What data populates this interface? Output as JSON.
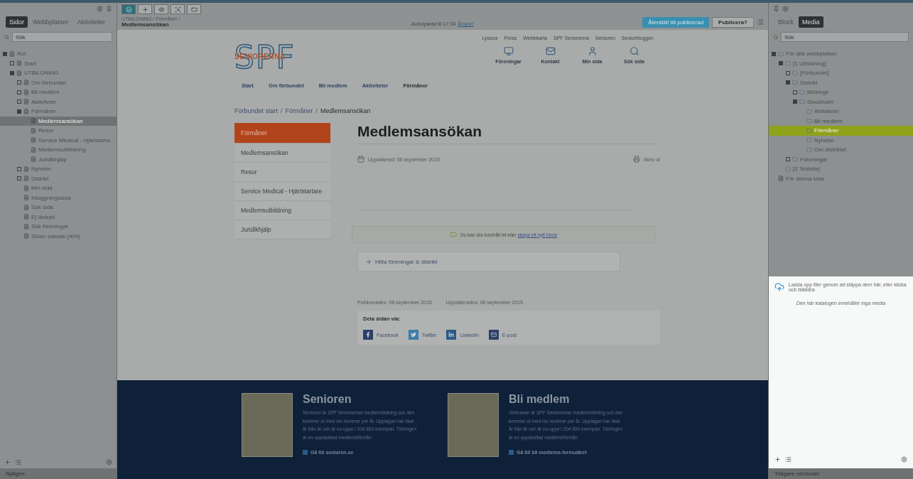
{
  "left_panel": {
    "tabs": [
      {
        "label": "Sidor",
        "selected": true
      },
      {
        "label": "Webbplatser",
        "selected": false
      },
      {
        "label": "Aktiviteter",
        "selected": false
      }
    ],
    "search": {
      "placeholder": "Sök"
    },
    "tree": [
      {
        "label": "Rot",
        "expanded": true,
        "selected": false,
        "children": [
          {
            "label": "Start",
            "expanded": false,
            "selected": false
          },
          {
            "label": "UTBILDNING",
            "expanded": true,
            "selected": false,
            "children": [
              {
                "label": "Om förbundet",
                "expanded": false,
                "selected": false
              },
              {
                "label": "Bli medlem",
                "expanded": false,
                "selected": false
              },
              {
                "label": "Aktiviteter",
                "expanded": false,
                "selected": false
              },
              {
                "label": "Förmåner",
                "expanded": true,
                "selected": false,
                "children": [
                  {
                    "label": "Medlemsansökan",
                    "selected": true
                  },
                  {
                    "label": "Resor",
                    "selected": false
                  },
                  {
                    "label": "Service Medical - Hjärtstarta...",
                    "selected": false
                  },
                  {
                    "label": "Medlemsutbildning",
                    "selected": false
                  },
                  {
                    "label": "Juridikhjälp",
                    "selected": false
                  }
                ]
              },
              {
                "label": "Nyheter",
                "expanded": false,
                "selected": false
              },
              {
                "label": "Distrikt",
                "expanded": false,
                "selected": false
              },
              {
                "label": "Min sida",
                "selected": false
              },
              {
                "label": "Inloggningssida",
                "selected": false
              },
              {
                "label": "Sök sida",
                "selected": false
              },
              {
                "label": "Ej länkad",
                "selected": false
              },
              {
                "label": "Sök föreningar",
                "selected": false
              },
              {
                "label": "Sidan saknas (404)",
                "selected": false
              }
            ]
          }
        ]
      }
    ],
    "footer_label": "Nyligen"
  },
  "toolbar": {
    "breadcrumb": "UTBILDNING / Förmåner /",
    "page_title": "Medlemsansökan",
    "autosave": "Autosparad kl 17:34",
    "undo_link": "Ångra?",
    "revert_button": "Återställ till publicerad",
    "publish_button": "Publicera?"
  },
  "site": {
    "logo": {
      "letters": "SPF",
      "tagline": "SENIORERNA"
    },
    "top_links": [
      "Lyssna",
      "Press",
      "Webbkarta",
      "SPF Seniorerna",
      "Senioren",
      "Seniorbloggen"
    ],
    "quick_links": [
      {
        "kind": "groups",
        "label": "Föreningar"
      },
      {
        "kind": "contact",
        "label": "Kontakt"
      },
      {
        "kind": "user",
        "label": "Min sida"
      },
      {
        "kind": "search",
        "label": "Sök sida"
      }
    ],
    "nav": [
      {
        "label": "Start",
        "selected": false
      },
      {
        "label": "Om förbundet",
        "selected": false
      },
      {
        "label": "Bli medlem",
        "selected": false
      },
      {
        "label": "Aktiviteter",
        "selected": false
      },
      {
        "label": "Förmåner",
        "selected": true
      }
    ],
    "breadcrumb_separator": "/",
    "breadcrumb": [
      {
        "label": "Förbundet start",
        "link": true
      },
      {
        "label": "Förmåner",
        "link": true
      },
      {
        "label": "Medlemsansökan",
        "link": false
      }
    ],
    "side_menu": [
      {
        "label": "Förmåner",
        "selected": true
      },
      {
        "label": "Medlemsansökan",
        "selected": false
      },
      {
        "label": "Resor",
        "selected": false
      },
      {
        "label": "Service Medical - Hjärtstartare",
        "selected": false
      },
      {
        "label": "Medlemsutbildning",
        "selected": false
      },
      {
        "label": "Juridikhjälp",
        "selected": false
      }
    ],
    "title": "Medlemsansökan",
    "updated": "Uppdaterad: 08 september 2015",
    "print": "Skriv ut",
    "drop_notice": {
      "text": "Du kan dra innehåll hit eller",
      "link": "skapa ett nytt block"
    },
    "link_box": "Hitta föreningar & distrikt",
    "published": "Publicerades: 08 september 2015",
    "modified": "Uppdaterades: 08 september 2015",
    "share": {
      "title": "Dela sidan via:",
      "items": [
        {
          "kind": "facebook",
          "label": "Facebook"
        },
        {
          "kind": "twitter",
          "label": "Twitter"
        },
        {
          "kind": "linkedin",
          "label": "LinkedIn"
        },
        {
          "kind": "email",
          "label": "E-post"
        }
      ]
    },
    "footer": [
      {
        "title": "Senioren",
        "text": "Senioren är *SPF Seniorernas* medlemstidning och den kommer ut med nio nummer per år. Upplagan har ökat år från år och är nu uppe i 204 800 exemplar. Tidningen är en uppskattad medlemsförmån",
        "link": "Gå till senioren.se"
      },
      {
        "title": "Bli medlem",
        "text": "Veteranen är *SPF Seniorernas* medlemstidning och den kommer ut med nio nummer per år. Upplagan har ökat år från år och är nu uppe i 204 800 exemplar. Tidningen är en uppskattad medlemsförmån",
        "link": "Gå till bli medlems-formuläret"
      }
    ]
  },
  "right_panel": {
    "tabs": [
      {
        "label": "Block",
        "selected": false
      },
      {
        "label": "Media",
        "selected": true
      }
    ],
    "search": {
      "placeholder": "Sök"
    },
    "tree": [
      {
        "label": "För alla webbplatser",
        "kind": "folder",
        "expanded": true,
        "selected": false,
        "children": [
          {
            "label": "[1 Utbildning]",
            "kind": "folder",
            "expanded": true,
            "selected": false,
            "children": [
              {
                "label": "[Förbundet]",
                "kind": "folder",
                "expanded": false,
                "selected": false
              },
              {
                "label": "Distrikt",
                "kind": "folder",
                "expanded": true,
                "selected": false,
                "children": [
                  {
                    "label": "Blekinge",
                    "kind": "folder",
                    "expanded": false,
                    "selected": false
                  },
                  {
                    "label": "Stockholm",
                    "kind": "folder",
                    "expanded": true,
                    "selected": false,
                    "children": [
                      {
                        "label": "Aktiviteter",
                        "kind": "folder",
                        "selected": false
                      },
                      {
                        "label": "Bli medlem",
                        "kind": "folder",
                        "selected": false
                      },
                      {
                        "label": "Förmåner",
                        "kind": "folder",
                        "selected": true
                      },
                      {
                        "label": "Nyheter",
                        "kind": "folder",
                        "selected": false
                      },
                      {
                        "label": "Om distriktet",
                        "kind": "folder",
                        "selected": false
                      }
                    ]
                  }
                ]
              },
              {
                "label": "Föreningar",
                "kind": "folder",
                "expanded": false,
                "selected": false
              }
            ]
          },
          {
            "label": "[2 Testsite]",
            "kind": "folder",
            "selected": false
          }
        ]
      },
      {
        "label": "För denna sida",
        "kind": "page",
        "selected": false
      }
    ],
    "upload_hint": "Ladda upp filer genom att släppa dem här, eller klicka och bläddra",
    "empty_note": "Den här katalogen innehåller inga media",
    "footer_label": "Tidigare versioner"
  }
}
